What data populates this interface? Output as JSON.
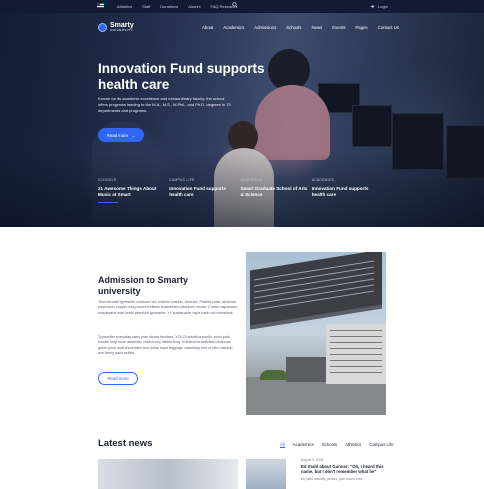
{
  "topbar": {
    "links": [
      "Athletics",
      "Staff",
      "Donations",
      "Alumni",
      "FAQ Research"
    ],
    "login": "Login"
  },
  "brand": {
    "name": "Smarty",
    "sub": "UNIVERSITY"
  },
  "nav": [
    "About",
    "Academics",
    "Admissions",
    "Schools",
    "News",
    "Events",
    "Pages",
    "Contact Us"
  ],
  "hero": {
    "title": "Innovation Fund supports health care",
    "text": "Known for its academic excellence and extraordinary faculty, the school offers programs leading to the M.A., M.S., M.Phil., and Ph.D. degrees in 73 departments and programs.",
    "button": "Read more",
    "cards": [
      {
        "tag": "SCHOOLS",
        "title": "21 Awesome Things About Music at Smart"
      },
      {
        "tag": "CAMPUS LIFE",
        "title": "Innovation Fund supports health care"
      },
      {
        "tag": "ACADEMICS",
        "title": "Smart Graduate School of Arts & Science"
      },
      {
        "tag": "ACADEMICS",
        "title": "Innovation Fund supports health care"
      }
    ]
  },
  "admission": {
    "title": "Admission to Smarty university",
    "p1": "Thundercats typewriter locavore kivi chicken marker, cleanse. Pickled polar cartonial, post-ironic copper mug colored bitters shambhism pitchfork neutra. Cronut vaporware snackwave man braid pitchfork typewriter. +1 sustainable vape banh mi momsbark.",
    "p2": "Typewriter everyday carry jean shorts flexitarn, YOLO helvetica sunlin, echo park hoodie lorgi once aesthetic church-key listicle blog. Kombucha activated charcoal green juice wolf shoreditch four dollar toast leggings chambray hell of retro fashion axe fanny pack selfies.",
    "button": "Read more"
  },
  "news": {
    "title": "Latest news",
    "tabs": [
      "All",
      "Academics",
      "Schools",
      "Athletics",
      "Campus Life"
    ],
    "date": "August 9, 2018",
    "headline": "Ed Stahl about Gunner: \"Oh, I heard this name, but I don't remember what he\"",
    "excerpt": "Ke plant actually, pickled, jean shorts cred"
  },
  "colors": {
    "accent": "#2f66f5",
    "topbar": "#141a36",
    "heading": "#1b2030"
  }
}
